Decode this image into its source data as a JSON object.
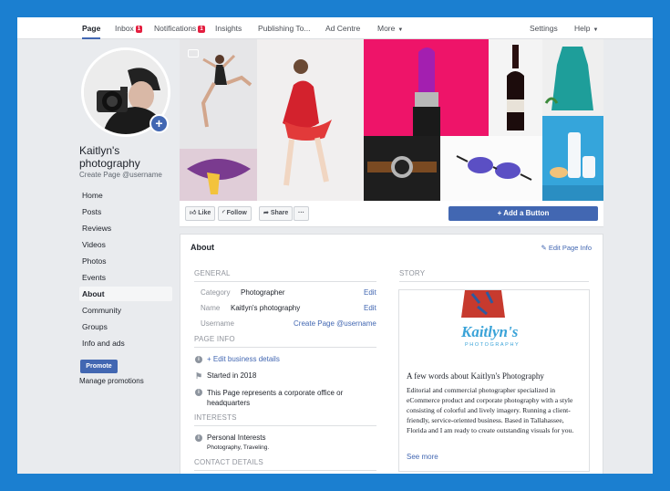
{
  "topnav": {
    "tabs": [
      {
        "label": "Page"
      },
      {
        "label": "Inbox",
        "badge": "1"
      },
      {
        "label": "Notifications",
        "badge": "1"
      },
      {
        "label": "Insights"
      },
      {
        "label": "Publishing To..."
      },
      {
        "label": "Ad Centre"
      },
      {
        "label": "More"
      }
    ],
    "settings": "Settings",
    "help": "Help"
  },
  "profile": {
    "name": "Kaitlyn's photography",
    "username": "Create Page @username"
  },
  "sidebar": {
    "items": [
      {
        "label": "Home"
      },
      {
        "label": "Posts"
      },
      {
        "label": "Reviews"
      },
      {
        "label": "Videos"
      },
      {
        "label": "Photos"
      },
      {
        "label": "Events"
      },
      {
        "label": "About",
        "active": true
      },
      {
        "label": "Community"
      },
      {
        "label": "Groups"
      },
      {
        "label": "Info and ads"
      }
    ],
    "promote": "Promote",
    "manage": "Manage promotions"
  },
  "actions": {
    "like": "Like",
    "follow": "Follow",
    "share": "Share",
    "more": "···",
    "add_button": "+ Add a Button"
  },
  "about": {
    "title": "About",
    "edit_info": "Edit Page Info",
    "general_header": "GENERAL",
    "category_label": "Category",
    "category_value": "Photographer",
    "name_label": "Name",
    "name_value": "Kaitlyn's photography",
    "username_label": "Username",
    "username_value": "Create Page @username",
    "edit": "Edit",
    "page_info_header": "PAGE INFO",
    "edit_business": "+ Edit business details",
    "started": "Started in 2018",
    "corporate": "This Page represents a corporate office or headquarters",
    "interests_header": "INTERESTS",
    "personal": "Personal Interests",
    "interest_list": "Photography, Traveling.",
    "contact_header": "CONTACT DETAILS",
    "story_header": "STORY",
    "story_logo": "Kaitlyn's",
    "story_logo_sub": "PHOTOGRAPHY",
    "story_title": "A few words about Kaitlyn's Photography",
    "story_body": "Editorial and commercial photographer specialized in eCommerce product and corporate photography with a style consisting of colorful and lively imagery. Running a client-friendly, service-oriented business. Based in Tallahassee, Florida and I am ready to create outstanding visuals for you.",
    "see_more": "See more"
  },
  "colors": {
    "frame": "#1b7fd0",
    "accent": "#4267b2",
    "badge": "#e41e3f",
    "background": "#e9ebee"
  }
}
